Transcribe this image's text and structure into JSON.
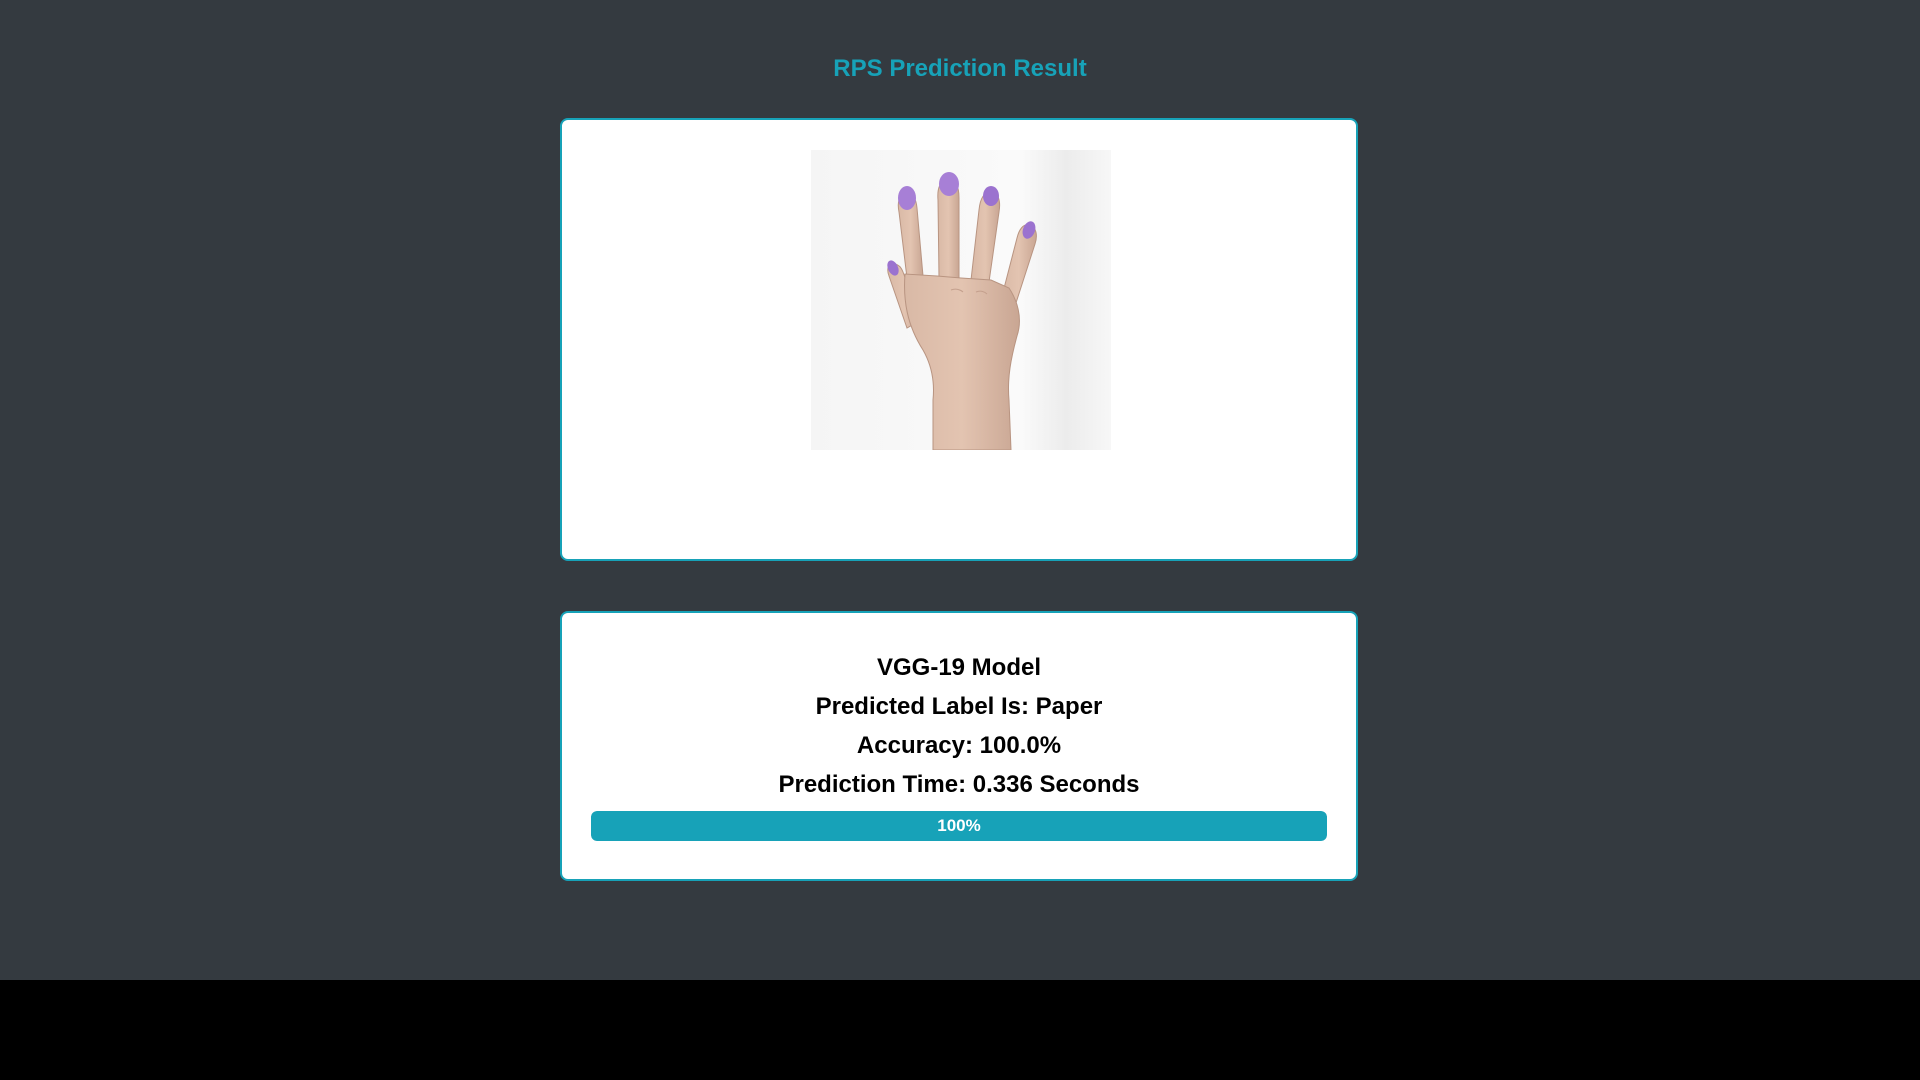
{
  "header": {
    "title": "RPS Prediction Result"
  },
  "image": {
    "icon": "open-hand-paper-image"
  },
  "result": {
    "model": "VGG-19 Model",
    "predicted_label": "Predicted Label Is: Paper",
    "accuracy": "Accuracy: 100.0%",
    "prediction_time": "Prediction Time: 0.336 Seconds",
    "progress_label": "100%",
    "progress_fraction": 1.0
  },
  "colors": {
    "accent": "#17a2b8",
    "background": "#343a40",
    "card": "#ffffff",
    "nail": "#a77fd6"
  }
}
